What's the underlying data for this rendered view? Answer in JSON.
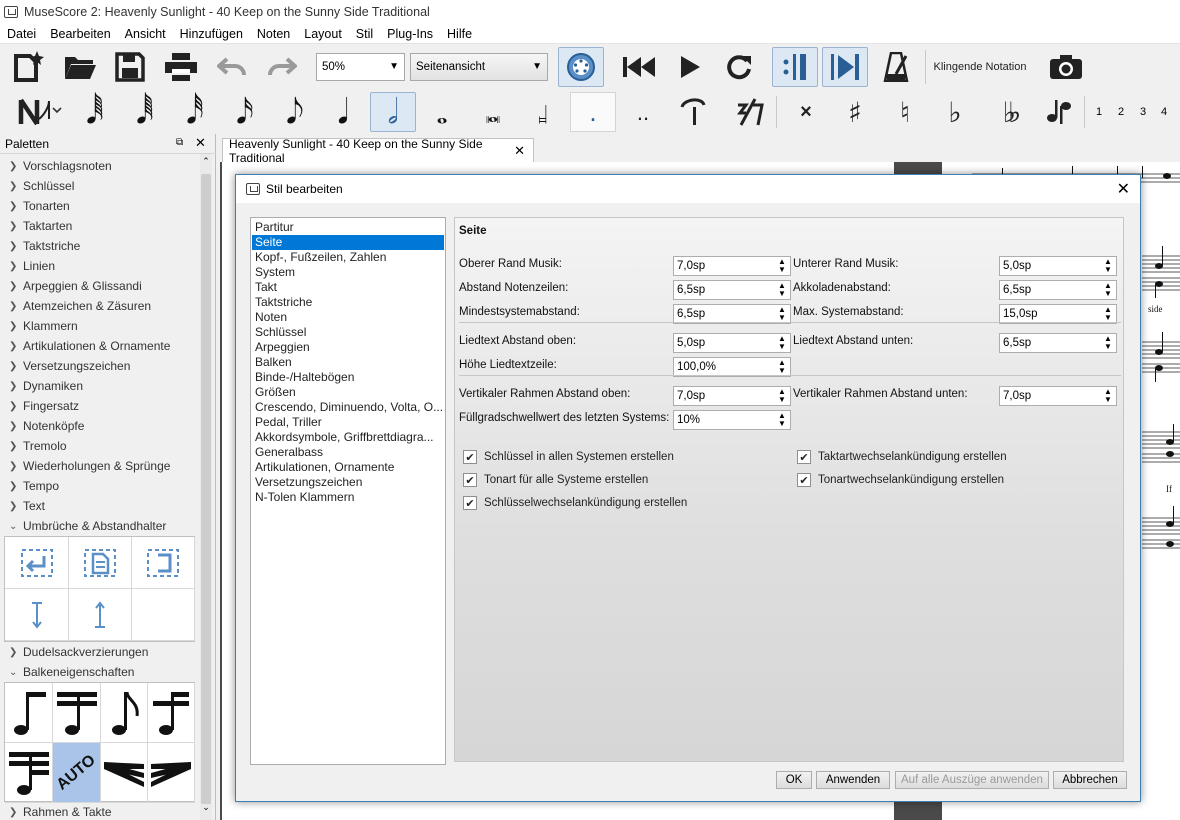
{
  "window": {
    "title": "MuseScore 2: Heavenly Sunlight - 40 Keep on the Sunny Side Traditional"
  },
  "menu": [
    "Datei",
    "Bearbeiten",
    "Ansicht",
    "Hinzufügen",
    "Noten",
    "Layout",
    "Stil",
    "Plug-Ins",
    "Hilfe"
  ],
  "toolbar": {
    "zoom_value": "50%",
    "view_mode": "Seitenansicht",
    "concert_pitch_label": "Klingende Notation",
    "voice_numbers": [
      "1",
      "2",
      "3",
      "4"
    ]
  },
  "palette": {
    "header": "Paletten",
    "items": [
      "Vorschlagsnoten",
      "Schlüssel",
      "Tonarten",
      "Taktarten",
      "Taktstriche",
      "Linien",
      "Arpeggien & Glissandi",
      "Atemzeichen & Zäsuren",
      "Klammern",
      "Artikulationen & Ornamente",
      "Versetzungszeichen",
      "Dynamiken",
      "Fingersatz",
      "Notenköpfe",
      "Tremolo",
      "Wiederholungen & Sprünge",
      "Tempo",
      "Text",
      "Umbrüche & Abstandhalter"
    ],
    "items_after": [
      "Dudelsackverzierungen",
      "Balkeneigenschaften"
    ],
    "items_bottom": [
      "Rahmen & Takte"
    ],
    "beam_auto_label": "AUTO"
  },
  "score_tab": {
    "title": "Heavenly Sunlight - 40 Keep on the Sunny Side Traditional"
  },
  "score_text": {
    "side": "side",
    "if": "If"
  },
  "dialog": {
    "title": "Stil bearbeiten",
    "categories": [
      "Partitur",
      "Seite",
      "Kopf-, Fußzeilen, Zahlen",
      "System",
      "Takt",
      "Taktstriche",
      "Noten",
      "Schlüssel",
      "Arpeggien",
      "Balken",
      "Binde-/Haltebögen",
      "Größen",
      "Crescendo, Diminuendo, Volta, O...",
      "Pedal, Triller",
      "Akkordsymbole, Griffbrettdiagra...",
      "Generalbass",
      "Artikulationen, Ornamente",
      "Versetzungszeichen",
      "N-Tolen Klammern"
    ],
    "selected_category": "Seite",
    "section_title": "Seite",
    "fields_left": [
      {
        "label": "Oberer Rand Musik:",
        "value": "7,0sp"
      },
      {
        "label": "Abstand Notenzeilen:",
        "value": "6,5sp"
      },
      {
        "label": "Mindestsystemabstand:",
        "value": "6,5sp"
      },
      {
        "label": "Liedtext Abstand oben:",
        "value": "5,0sp"
      },
      {
        "label": "Höhe Liedtextzeile:",
        "value": "100,0%"
      },
      {
        "label": "Vertikaler Rahmen Abstand oben:",
        "value": "7,0sp"
      },
      {
        "label": "Füllgradschwellwert des letzten Systems:",
        "value": "10%"
      }
    ],
    "fields_right": [
      {
        "label": "Unterer Rand Musik:",
        "value": "5,0sp"
      },
      {
        "label": "Akkoladenabstand:",
        "value": "6,5sp"
      },
      {
        "label": "Max. Systemabstand:",
        "value": "15,0sp"
      },
      {
        "label": "Liedtext Abstand unten:",
        "value": "6,5sp"
      },
      {
        "label": "Vertikaler Rahmen Abstand unten:",
        "value": "7,0sp"
      }
    ],
    "checkboxes_left": [
      {
        "label": "Schlüssel in allen Systemen erstellen",
        "checked": true
      },
      {
        "label": "Tonart für alle Systeme erstellen",
        "checked": true
      },
      {
        "label": "Schlüsselwechselankündigung erstellen",
        "checked": true
      }
    ],
    "checkboxes_right": [
      {
        "label": "Taktartwechselankündigung erstellen",
        "checked": true
      },
      {
        "label": "Tonartwechselankündigung erstellen",
        "checked": true
      }
    ],
    "buttons": {
      "ok": "OK",
      "apply": "Anwenden",
      "apply_all": "Auf alle Auszüge anwenden",
      "cancel": "Abbrechen"
    }
  }
}
